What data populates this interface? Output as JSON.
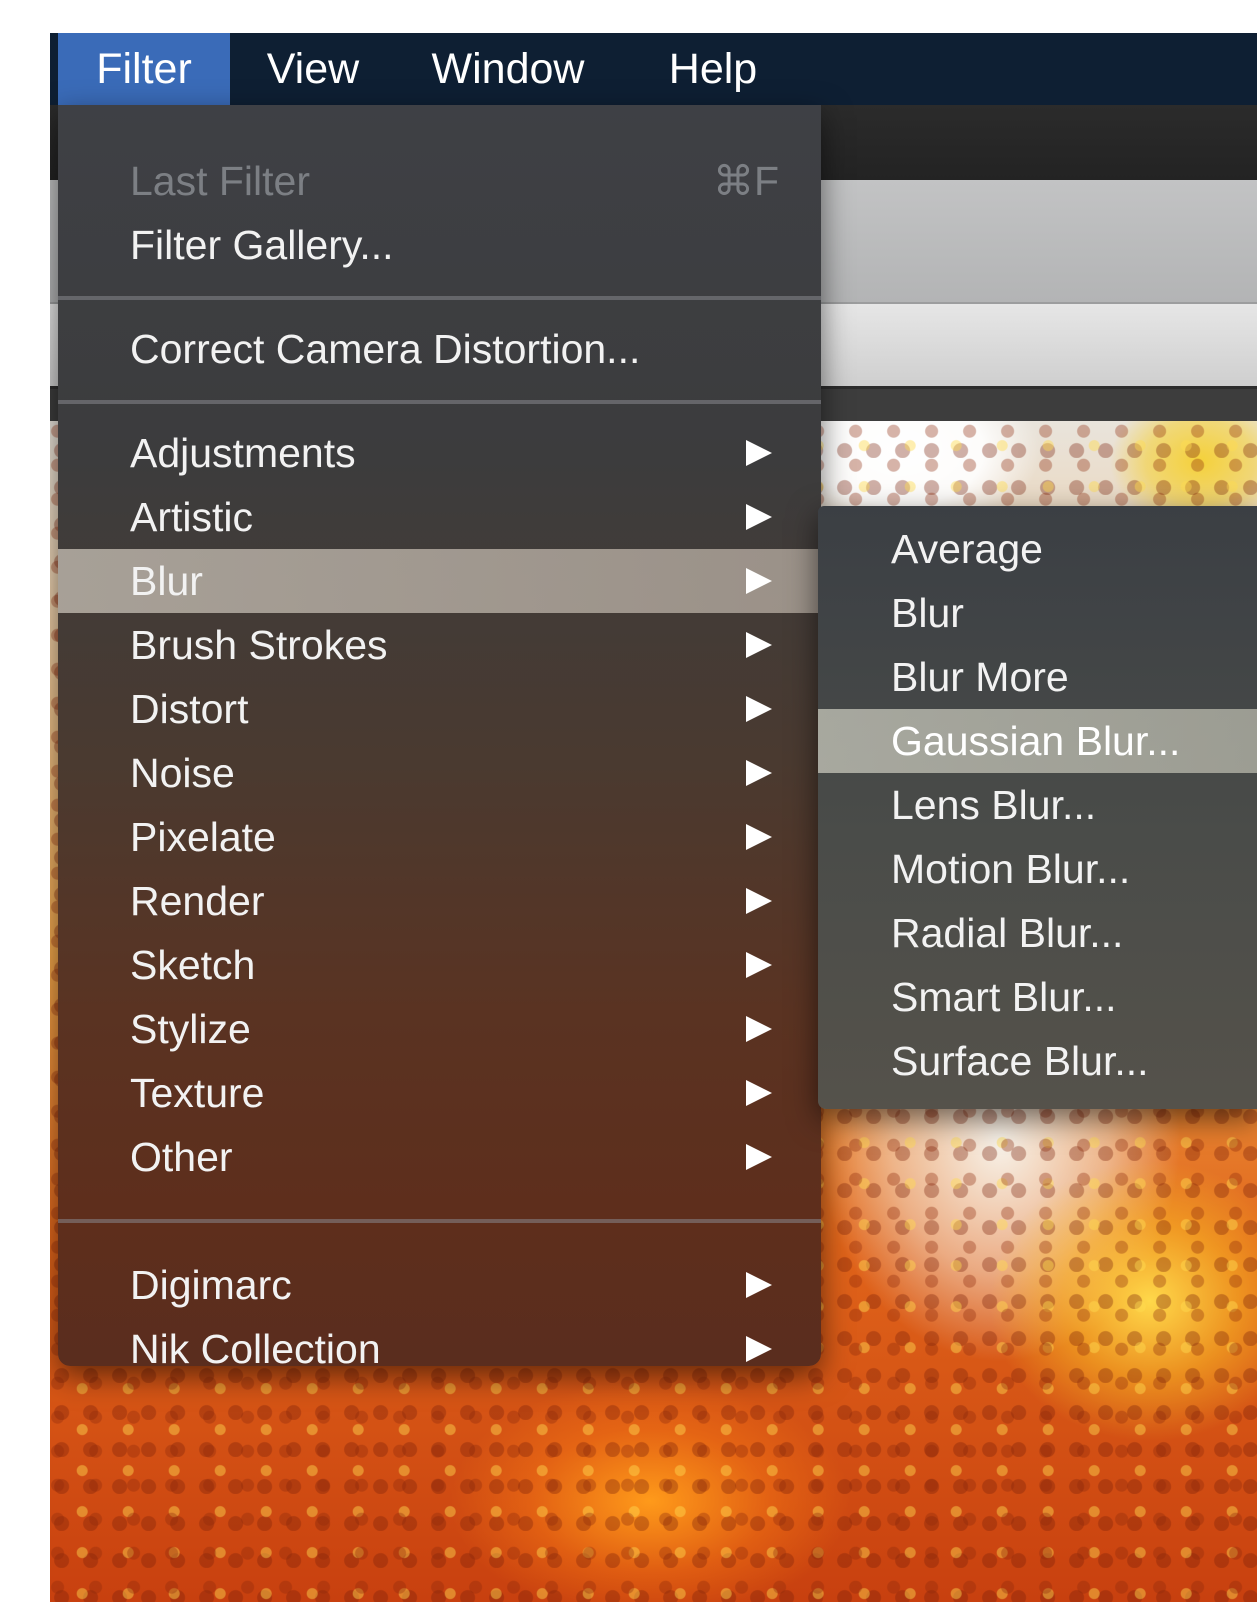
{
  "menubar": {
    "items": [
      {
        "label": "Filter",
        "active": true
      },
      {
        "label": "View",
        "active": false
      },
      {
        "label": "Window",
        "active": false
      },
      {
        "label": "Help",
        "active": false
      }
    ]
  },
  "filter_menu": {
    "last_filter": {
      "label": "Last Filter",
      "shortcut": "⌘F",
      "disabled": true
    },
    "filter_gallery": {
      "label": "Filter Gallery..."
    },
    "correct_camera_distortion": {
      "label": "Correct Camera Distortion..."
    },
    "categories": [
      {
        "label": "Adjustments",
        "has_submenu": true
      },
      {
        "label": "Artistic",
        "has_submenu": true
      },
      {
        "label": "Blur",
        "has_submenu": true,
        "highlighted": true
      },
      {
        "label": "Brush Strokes",
        "has_submenu": true
      },
      {
        "label": "Distort",
        "has_submenu": true
      },
      {
        "label": "Noise",
        "has_submenu": true
      },
      {
        "label": "Pixelate",
        "has_submenu": true
      },
      {
        "label": "Render",
        "has_submenu": true
      },
      {
        "label": "Sketch",
        "has_submenu": true
      },
      {
        "label": "Stylize",
        "has_submenu": true
      },
      {
        "label": "Texture",
        "has_submenu": true
      },
      {
        "label": "Other",
        "has_submenu": true
      }
    ],
    "plugins": [
      {
        "label": "Digimarc",
        "has_submenu": true
      },
      {
        "label": "Nik Collection",
        "has_submenu": true
      }
    ]
  },
  "blur_submenu": {
    "items": [
      {
        "label": "Average"
      },
      {
        "label": "Blur"
      },
      {
        "label": "Blur More"
      },
      {
        "label": "Gaussian Blur...",
        "highlighted": true
      },
      {
        "label": "Lens Blur..."
      },
      {
        "label": "Motion Blur..."
      },
      {
        "label": "Radial Blur..."
      },
      {
        "label": "Smart Blur..."
      },
      {
        "label": "Surface Blur..."
      }
    ]
  },
  "icons": {
    "submenu_arrow": "submenu-arrow-icon"
  },
  "colors": {
    "menubar_bg": "#0e1f33",
    "menubar_active": "#3a6bb8",
    "menu_highlight": "#b9b2a8",
    "submenu_highlight": "#c8c8bc",
    "disabled_text": "#7c7f84"
  }
}
